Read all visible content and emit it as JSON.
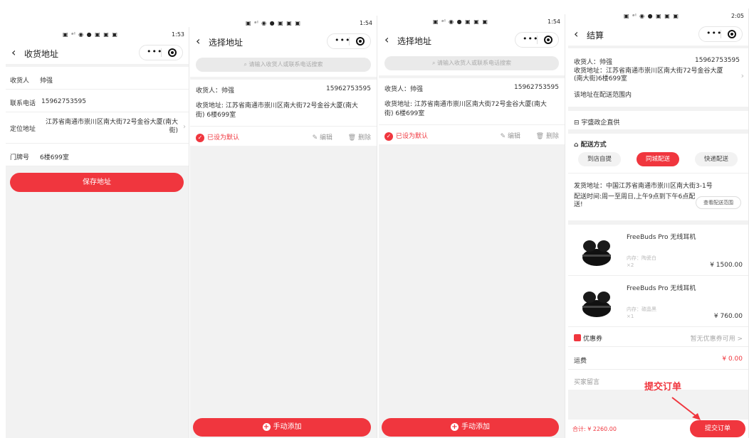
{
  "accent": "#f0363e",
  "screen1": {
    "status_right": "1:53",
    "title": "收货地址",
    "receiver_label": "收货人",
    "receiver_value": "帅强",
    "phone_label": "联系电话",
    "phone_value": "15962753595",
    "location_label": "定位地址",
    "location_value": "江苏省南通市崇川区南大街72号金谷大厦(南大街)",
    "door_label": "门牌号",
    "door_value": "6楼699室",
    "save_label": "保存地址"
  },
  "screen2": {
    "status_right": "1:54",
    "title": "选择地址",
    "search_placeholder": "请输入收货人或联系电话搜索",
    "card": {
      "receiver": "收货人：帅强",
      "phone": "15962753595",
      "address": "收货地址: 江苏省南通市崇川区南大街72号金谷大厦(南大街) 6楼699室",
      "default_label": "已设为默认",
      "edit_label": "编辑",
      "delete_label": "删除"
    },
    "add_label": "手动添加"
  },
  "screen3": {
    "status_right": "1:54",
    "title": "选择地址",
    "search_placeholder": "请输入收货人或联系电话搜索",
    "card": {
      "receiver": "收货人：帅强",
      "phone": "15962753595",
      "address": "收货地址: 江苏省南通市崇川区南大街72号金谷大厦(南大街) 6楼699室",
      "default_label": "已设为默认",
      "edit_label": "编辑",
      "delete_label": "删除"
    },
    "add_label": "手动添加"
  },
  "screen4": {
    "status_right": "2:05",
    "title": "结算",
    "receiver": "收货人：帅强",
    "phone": "15962753595",
    "address": "收货地址：江苏省南通市崇川区南大街72号金谷大厦(南大街)6楼699室",
    "in_range": "该地址在配送范围内",
    "shop_name": "宇盛政企直供",
    "delivery_title": "配送方式",
    "delivery_options": [
      "到店自提",
      "同城配送",
      "快递配送"
    ],
    "ship_from": "发货地址：中国江苏省南通市崇川区南大街3-1号",
    "ship_time": "配送时间:周一至周日,上午9点到下午6点配送!",
    "range_button": "查看配送范围",
    "products": [
      {
        "name": "FreeBuds Pro 无线耳机",
        "spec": "内存：陶瓷白",
        "qty": "×2",
        "price": "¥ 1500.00"
      },
      {
        "name": "FreeBuds Pro 无线耳机",
        "spec": "内存：碳晶黑",
        "qty": "×1",
        "price": "¥ 760.00"
      }
    ],
    "coupon_label": "优惠券",
    "coupon_value": "暂无优惠券可用 >",
    "freight_label": "运费",
    "freight_value": "¥ 0.00",
    "message_label": "买家留言",
    "total": "合计: ¥ 2260.00",
    "submit_label": "提交订单",
    "annotation": "提交订单"
  }
}
